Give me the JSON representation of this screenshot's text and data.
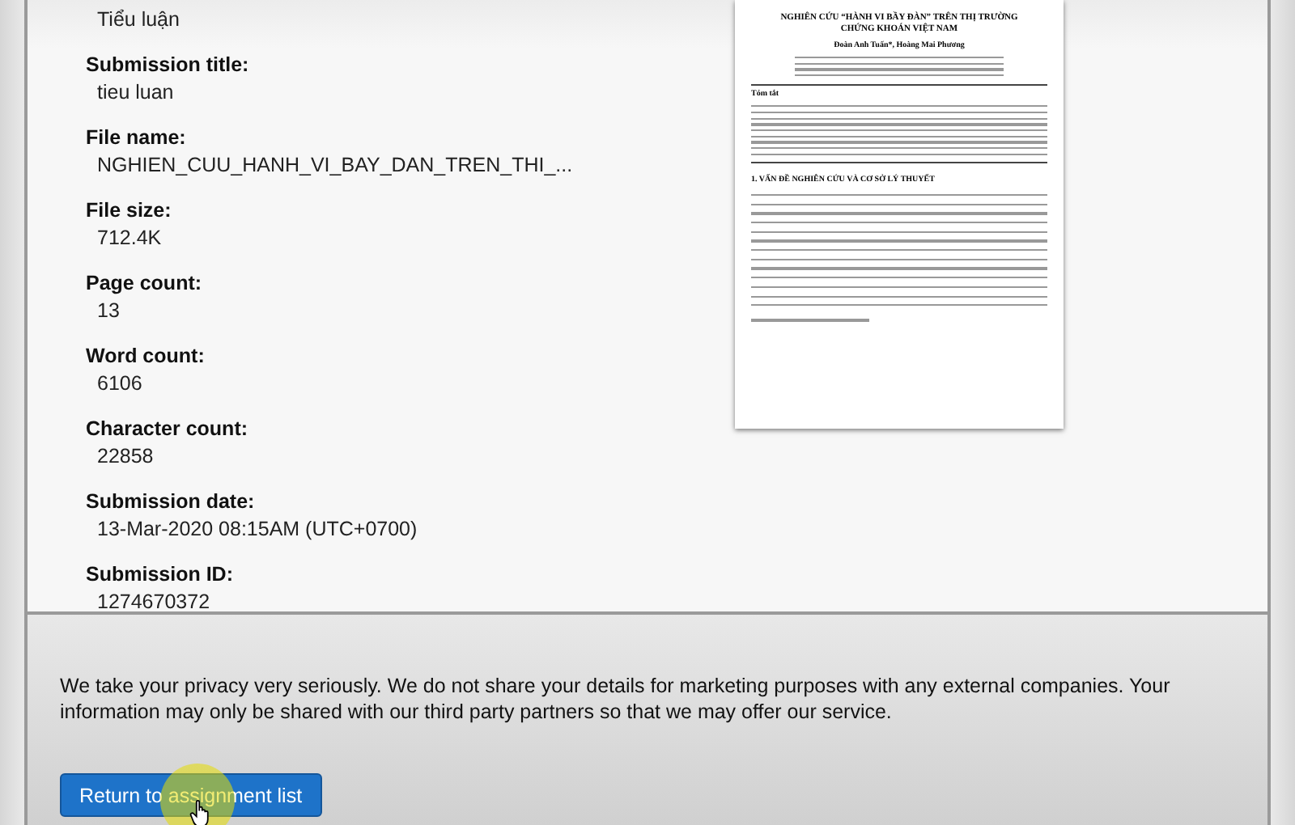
{
  "partial_field": {
    "value": "Tiểu luận"
  },
  "fields": [
    {
      "label": "Submission title:",
      "value": "tieu luan"
    },
    {
      "label": "File name:",
      "value": "NGHIEN_CUU_HANH_VI_BAY_DAN_TREN_THI_..."
    },
    {
      "label": "File size:",
      "value": "712.4K"
    },
    {
      "label": "Page count:",
      "value": "13"
    },
    {
      "label": "Word count:",
      "value": "6106"
    },
    {
      "label": "Character count:",
      "value": "22858"
    },
    {
      "label": "Submission date:",
      "value": "13-Mar-2020 08:15AM (UTC+0700)"
    },
    {
      "label": "Submission ID:",
      "value": "1274670372"
    }
  ],
  "preview": {
    "title": "NGHIÊN CỨU “HÀNH VI BẦY ĐÀN” TRÊN THỊ TRƯỜNG CHỨNG KHOÁN VIỆT NAM",
    "authors": "Đoàn Anh Tuấn*, Hoàng Mai Phương",
    "abstract_heading": "Tóm tắt",
    "section_heading": "1.    VẤN ĐỀ NGHIÊN CỨU VÀ CƠ SỞ LÝ THUYẾT"
  },
  "privacy_notice": "We take your privacy very seriously. We do not share your details for marketing purposes with any external companies. Your information may only be shared with our third party partners so that we may offer our service.",
  "return_button": "Return to assignment list"
}
